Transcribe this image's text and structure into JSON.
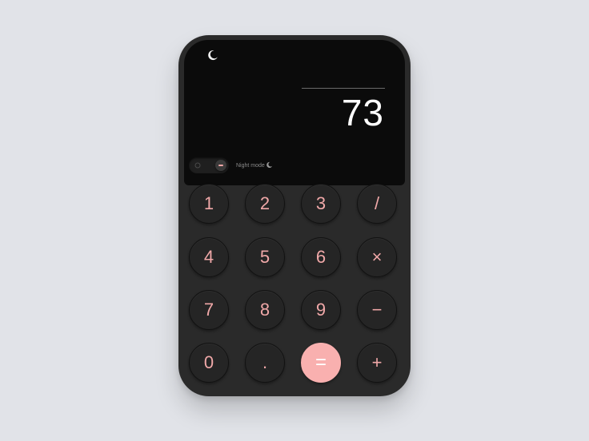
{
  "display": {
    "result": "73",
    "theme_icon": "crescent-moon-icon"
  },
  "toolbar": {
    "night_mode_label": "Night mode",
    "night_mode_enabled": true,
    "night_mode_icon": "moon-icon"
  },
  "keypad": {
    "rows": [
      [
        "1",
        "2",
        "3",
        "/"
      ],
      [
        "4",
        "5",
        "6",
        "×"
      ],
      [
        "7",
        "8",
        "9",
        "−"
      ],
      [
        "0",
        ".",
        "=",
        "+"
      ]
    ]
  },
  "colors": {
    "accent": "#f9b0af",
    "key_text": "#f0a8a8",
    "body": "#2a2a2a",
    "screen": "#0b0b0b",
    "background": "#e1e3e8"
  }
}
